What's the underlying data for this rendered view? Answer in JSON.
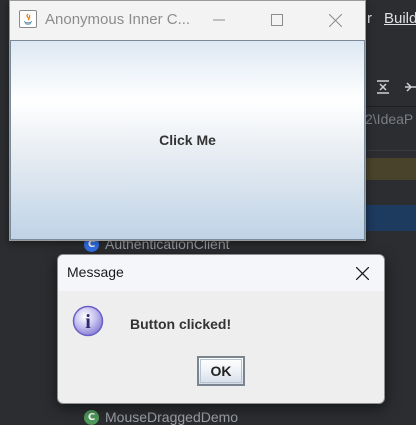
{
  "ide": {
    "menu_partial": "r",
    "menu_build": "Build",
    "toolbar_icons": [
      "collapse-all-icon",
      "expand-icon"
    ],
    "path_fragment": "2\\IdeaP",
    "tree_items": [
      {
        "label": "AuthenticationClient",
        "icon": "class-icon"
      },
      {
        "label": "MouseDraggedDemo",
        "icon": "class-icon"
      }
    ]
  },
  "frame": {
    "title": "Anonymous Inner C...",
    "minimize_glyph": "—",
    "maximize_glyph": "☐",
    "close_glyph": "✕",
    "button_label": "Click Me"
  },
  "dialog": {
    "title": "Message",
    "close_glyph": "✕",
    "message": "Button clicked!",
    "ok_label": "OK",
    "icon": "information-icon",
    "icon_glyph": "i"
  },
  "colors": {
    "ide_background": "#2b2d30",
    "frame_background": "#f3f3f3",
    "button_gradient_top": "#ffffff",
    "button_gradient_bottom": "#bfd3e6",
    "dialog_background": "#eeeeee",
    "info_icon": "#7a6fcf"
  }
}
